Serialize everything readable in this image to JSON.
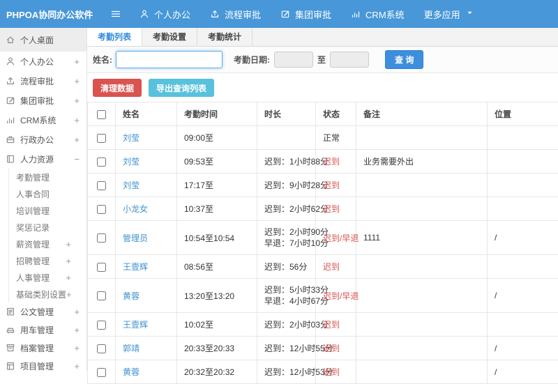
{
  "navbar": {
    "brand": "PHPOA协同办公软件",
    "menu": [
      {
        "icon": "user-icon",
        "label": "个人办公",
        "caret": false
      },
      {
        "icon": "flow-icon",
        "label": "流程审批",
        "caret": false
      },
      {
        "icon": "edit-icon",
        "label": "集团审批",
        "caret": false
      },
      {
        "icon": "chart-icon",
        "label": "CRM系统",
        "caret": false
      },
      {
        "icon": "",
        "label": "更多应用",
        "caret": true
      }
    ]
  },
  "sidebar": {
    "items": [
      {
        "type": "top",
        "icon": "home-icon",
        "label": "个人桌面",
        "expand": "",
        "active": true
      },
      {
        "type": "top",
        "icon": "user-icon",
        "label": "个人办公",
        "expand": "+",
        "active": false
      },
      {
        "type": "top",
        "icon": "flow-icon",
        "label": "流程审批",
        "expand": "+",
        "active": false
      },
      {
        "type": "top",
        "icon": "edit-icon",
        "label": "集团审批",
        "expand": "+",
        "active": false
      },
      {
        "type": "top",
        "icon": "chart-icon",
        "label": "CRM系统",
        "expand": "+",
        "active": false
      },
      {
        "type": "top",
        "icon": "briefcase-icon",
        "label": "行政办公",
        "expand": "+",
        "active": false
      },
      {
        "type": "top",
        "icon": "book-icon",
        "label": "人力资源",
        "expand": "−",
        "active": false
      },
      {
        "type": "sub",
        "icon": "",
        "label": "考勤管理",
        "expand": "",
        "active": false
      },
      {
        "type": "sub",
        "icon": "",
        "label": "人事合同",
        "expand": "",
        "active": false
      },
      {
        "type": "sub",
        "icon": "",
        "label": "培训管理",
        "expand": "",
        "active": false
      },
      {
        "type": "sub",
        "icon": "",
        "label": "奖惩记录",
        "expand": "",
        "active": false
      },
      {
        "type": "sub",
        "icon": "",
        "label": "薪资管理",
        "expand": "+",
        "active": false
      },
      {
        "type": "sub",
        "icon": "",
        "label": "招聘管理",
        "expand": "+",
        "active": false
      },
      {
        "type": "sub",
        "icon": "",
        "label": "人事管理",
        "expand": "+",
        "active": false
      },
      {
        "type": "sub",
        "icon": "",
        "label": "基础类别设置",
        "expand": "+",
        "active": false
      },
      {
        "type": "grp",
        "icon": "doc-icon",
        "label": "公文管理",
        "expand": "+",
        "active": false
      },
      {
        "type": "grp",
        "icon": "car-icon",
        "label": "用车管理",
        "expand": "+",
        "active": false
      },
      {
        "type": "grp",
        "icon": "archive-icon",
        "label": "档案管理",
        "expand": "+",
        "active": false
      },
      {
        "type": "grp",
        "icon": "project-icon",
        "label": "项目管理",
        "expand": "+",
        "active": false
      }
    ]
  },
  "tabs": [
    {
      "label": "考勤列表",
      "active": true
    },
    {
      "label": "考勤设置",
      "active": false
    },
    {
      "label": "考勤统计",
      "active": false
    }
  ],
  "filter": {
    "name_label": "姓名:",
    "name_value": "",
    "date_label": "考勤日期:",
    "to_label": "至",
    "date_from_value": "",
    "date_to_value": "",
    "search_button": "查 询"
  },
  "actions": {
    "clean_button": "清理数据",
    "export_button": "导出查询列表"
  },
  "table": {
    "headers": [
      "姓名",
      "考勤时间",
      "时长",
      "状态",
      "备注",
      "位置"
    ],
    "rows": [
      {
        "name": "刘莹",
        "time": "09:00至",
        "duration": "",
        "duration2": "",
        "status": "正常",
        "status_red": false,
        "note": "",
        "location": ""
      },
      {
        "name": "刘莹",
        "time": "09:53至",
        "duration": "迟到：1小时88分",
        "duration2": "",
        "status": "迟到",
        "status_red": true,
        "note": "业务需要外出",
        "location": ""
      },
      {
        "name": "刘莹",
        "time": "17:17至",
        "duration": "迟到：9小时28分",
        "duration2": "",
        "status": "迟到",
        "status_red": true,
        "note": "",
        "location": ""
      },
      {
        "name": "小龙女",
        "time": "10:37至",
        "duration": "迟到：2小时62分",
        "duration2": "",
        "status": "迟到",
        "status_red": true,
        "note": "",
        "location": ""
      },
      {
        "name": "管理员",
        "time": "10:54至10:54",
        "duration": "迟到：2小时90分",
        "duration2": "早退：7小时10分",
        "status": "迟到/早退",
        "status_red": true,
        "note": "1111",
        "location": "/"
      },
      {
        "name": "王壹辉",
        "time": "08:56至",
        "duration": "迟到：56分",
        "duration2": "",
        "status": "迟到",
        "status_red": true,
        "note": "",
        "location": ""
      },
      {
        "name": "黄蓉",
        "time": "13:20至13:20",
        "duration": "迟到：5小时33分",
        "duration2": "早退：4小时67分",
        "status": "迟到/早退",
        "status_red": true,
        "note": "",
        "location": "/"
      },
      {
        "name": "王壹辉",
        "time": "10:02至",
        "duration": "迟到：2小时03分",
        "duration2": "",
        "status": "迟到",
        "status_red": true,
        "note": "",
        "location": ""
      },
      {
        "name": "郭靖",
        "time": "20:33至20:33",
        "duration": "迟到：12小时55分",
        "duration2": "",
        "status": "迟到",
        "status_red": true,
        "note": "",
        "location": "/"
      },
      {
        "name": "黄蓉",
        "time": "20:32至20:32",
        "duration": "迟到：12小时53分",
        "duration2": "",
        "status": "迟到",
        "status_red": true,
        "note": "",
        "location": "/"
      }
    ]
  },
  "colors": {
    "navbar_blue": "#4797d9",
    "accent_blue": "#3e8ede",
    "danger_red": "#d9534f",
    "info_teal": "#58c1dc",
    "link_blue": "#4093d0",
    "status_red": "#d9534f",
    "active_tab_blue": "#2f8bdb"
  }
}
